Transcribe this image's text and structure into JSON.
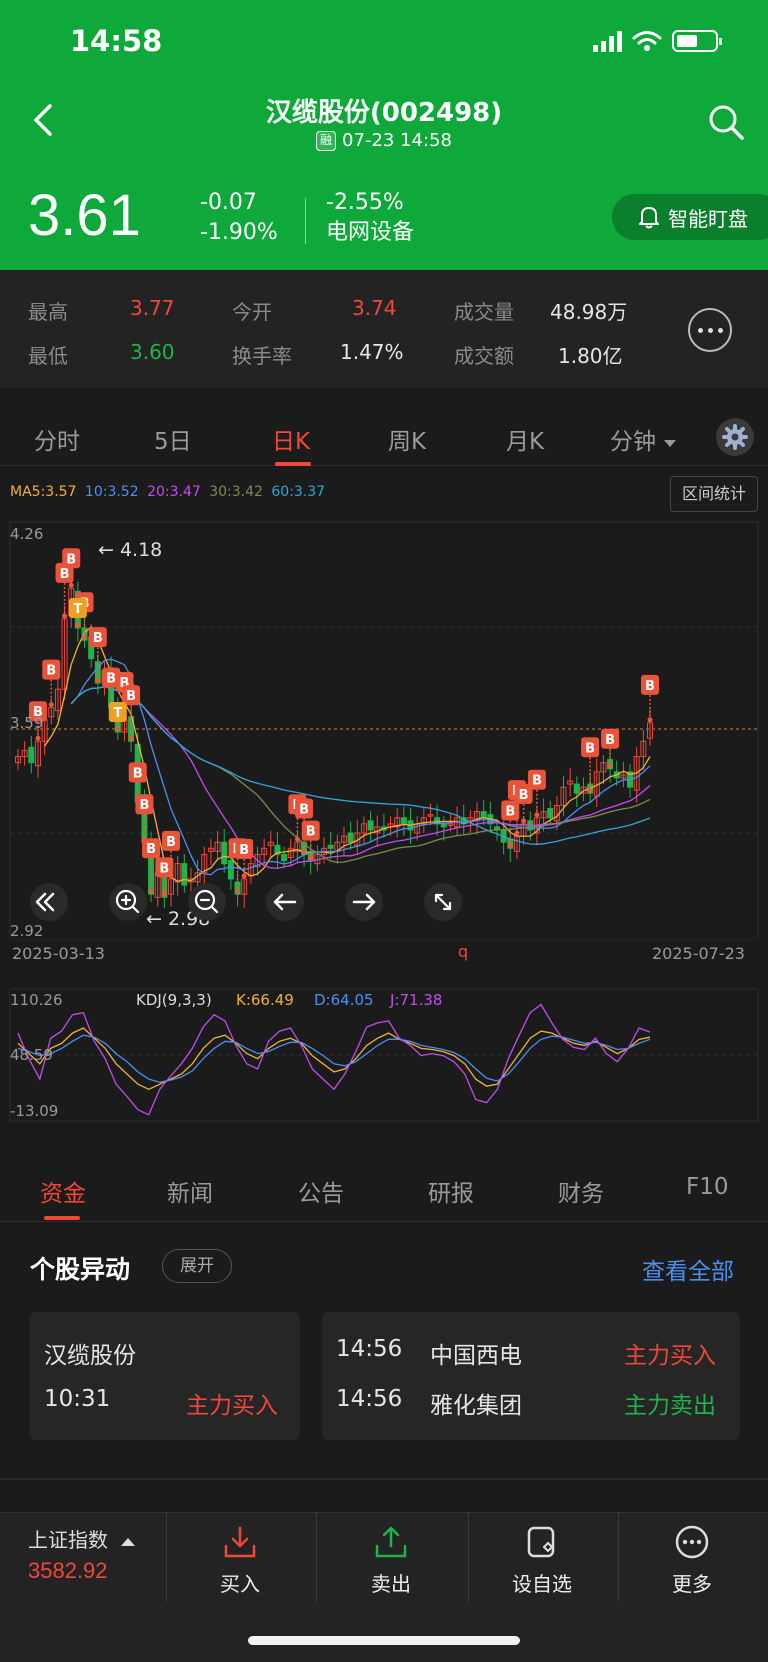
{
  "status": {
    "time": "14:58"
  },
  "header": {
    "title": "汉缆股份(002498)",
    "subtitle_badge": "融",
    "subtitle": "07-23 14:58",
    "price": "3.61",
    "change": "-0.07",
    "change_pct_short": "-1.90%",
    "change_pct": "-2.55%",
    "sector": "电网设备",
    "watch_button": "智能盯盘"
  },
  "stats": {
    "high_label": "最高",
    "high": "3.77",
    "open_label": "今开",
    "open": "3.74",
    "volume_label": "成交量",
    "volume": "48.98万",
    "low_label": "最低",
    "low": "3.60",
    "turnover_label": "换手率",
    "turnover": "1.47%",
    "amount_label": "成交额",
    "amount": "1.80亿"
  },
  "kline_tabs": [
    "分时",
    "5日",
    "日K",
    "周K",
    "月K",
    "分钟"
  ],
  "ma": {
    "ma5": "MA5:3.57",
    "ma10": "10:3.52",
    "ma20": "20:3.47",
    "ma30": "30:3.42",
    "ma60": "60:3.37"
  },
  "range_button": "区间统计",
  "price_chart": {
    "y_max": "4.26",
    "y_mid": "3.59",
    "y_min": "2.92",
    "max_marker": "4.18",
    "min_marker": "2.98",
    "x_start": "2025-03-13",
    "x_end": "2025-07-23",
    "x_mid_label": "q",
    "buy_marker": "B",
    "t_marker": "T"
  },
  "kdj": {
    "title": "KDJ(9,3,3)",
    "k": "K:66.49",
    "d": "D:64.05",
    "j": "J:71.38",
    "y_max": "110.26",
    "y_mid": "48.59",
    "y_min": "-13.09"
  },
  "info_tabs": [
    "资金",
    "新闻",
    "公告",
    "研报",
    "财务",
    "F10"
  ],
  "section": {
    "title": "个股异动",
    "expand": "展开",
    "view_all": "查看全部",
    "card1": {
      "name": "汉缆股份",
      "time": "10:31",
      "action": "主力买入"
    },
    "card2": [
      {
        "time": "14:56",
        "name": "中国西电",
        "action": "主力买入"
      },
      {
        "time": "14:56",
        "name": "雅化集团",
        "action": "主力卖出"
      }
    ]
  },
  "bottom_nav": {
    "index_name": "上证指数",
    "index_value": "3582.92",
    "buy": "买入",
    "sell": "卖出",
    "watchlist": "设自选",
    "more": "更多"
  },
  "colors": {
    "up": "#f0473a",
    "down": "#1fb34c",
    "header": "#0fa83a",
    "link": "#4a8ff0"
  },
  "chart_data": {
    "type": "candlestick",
    "title": "",
    "x_range": [
      "2025-03-13",
      "2025-07-23"
    ],
    "ylim": [
      2.92,
      4.26
    ],
    "close": [
      3.5,
      3.52,
      3.48,
      3.55,
      3.62,
      3.66,
      3.72,
      3.95,
      4.05,
      3.92,
      3.88,
      3.82,
      3.74,
      3.78,
      3.66,
      3.58,
      3.62,
      3.55,
      3.35,
      3.22,
      3.05,
      3.12,
      3.04,
      3.1,
      3.15,
      3.08,
      3.1,
      3.12,
      3.18,
      3.2,
      3.22,
      3.15,
      3.1,
      3.05,
      3.1,
      3.15,
      3.18,
      3.2,
      3.22,
      3.18,
      3.16,
      3.2,
      3.22,
      3.18,
      3.16,
      3.18,
      3.2,
      3.2,
      3.22,
      3.24,
      3.22,
      3.25,
      3.28,
      3.26,
      3.27,
      3.26,
      3.28,
      3.3,
      3.28,
      3.26,
      3.28,
      3.3,
      3.31,
      3.28,
      3.27,
      3.28,
      3.3,
      3.28,
      3.3,
      3.32,
      3.3,
      3.28,
      3.26,
      3.22,
      3.2,
      3.24,
      3.28,
      3.26,
      3.3,
      3.32,
      3.3,
      3.34,
      3.4,
      3.42,
      3.38,
      3.4,
      3.38,
      3.45,
      3.48,
      3.46,
      3.43,
      3.44,
      3.4,
      3.5,
      3.55,
      3.61
    ],
    "kdj": {
      "k": [
        60,
        50,
        40,
        55,
        60,
        70,
        75,
        65,
        55,
        40,
        30,
        20,
        15,
        20,
        25,
        30,
        40,
        55,
        65,
        68,
        60,
        50,
        45,
        55,
        62,
        65,
        60,
        48,
        40,
        32,
        35,
        45,
        58,
        65,
        70,
        64,
        60,
        55,
        54,
        52,
        48,
        40,
        25,
        18,
        20,
        35,
        50,
        65,
        72,
        70,
        65,
        60,
        58,
        62,
        56,
        50,
        55,
        64,
        66
      ],
      "d": [
        55,
        52,
        48,
        50,
        55,
        62,
        68,
        66,
        60,
        50,
        42,
        32,
        25,
        22,
        24,
        27,
        33,
        45,
        55,
        62,
        61,
        55,
        50,
        52,
        57,
        61,
        61,
        55,
        48,
        40,
        38,
        42,
        50,
        58,
        64,
        64,
        62,
        58,
        56,
        54,
        51,
        45,
        35,
        26,
        23,
        30,
        42,
        55,
        64,
        67,
        66,
        63,
        60,
        61,
        58,
        54,
        55,
        60,
        64
      ],
      "j": [
        70,
        45,
        25,
        65,
        72,
        88,
        90,
        62,
        45,
        20,
        8,
        -5,
        -10,
        15,
        28,
        40,
        55,
        76,
        88,
        82,
        58,
        40,
        35,
        62,
        72,
        75,
        58,
        35,
        25,
        15,
        30,
        52,
        76,
        80,
        82,
        65,
        58,
        48,
        50,
        48,
        42,
        30,
        5,
        2,
        15,
        45,
        68,
        90,
        98,
        80,
        64,
        56,
        54,
        65,
        50,
        42,
        55,
        75,
        71
      ]
    }
  }
}
